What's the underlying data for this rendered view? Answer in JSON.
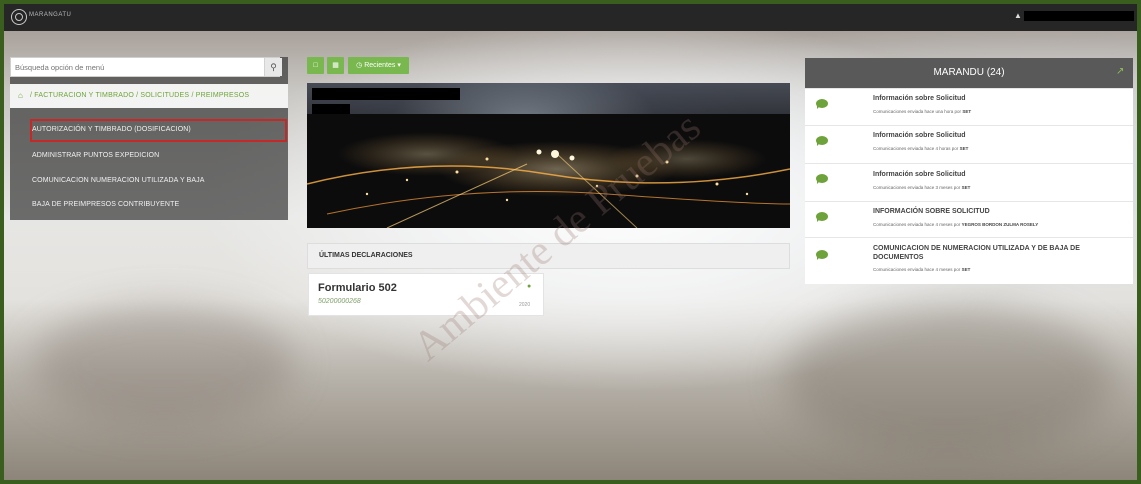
{
  "header": {
    "logo_text": "MARANGATU"
  },
  "search": {
    "placeholder": "Búsqueda opción de menú",
    "button_icon": "search-icon"
  },
  "breadcrumb": [
    "FACTURACION Y TIMBRADO",
    "SOLICITUDES",
    "PREIMPRESOS"
  ],
  "breadcrumb_text": "/ FACTURACION Y TIMBRADO / SOLICITUDES / PREIMPRESOS",
  "menu": [
    {
      "label": "AUTORIZACIÓN Y TIMBRADO (DOSIFICACION)",
      "selected": true
    },
    {
      "label": "ADMINISTRAR PUNTOS EXPEDICION"
    },
    {
      "label": "COMUNICACION NUMERACION UTILIZADA Y BAJA"
    },
    {
      "label": "BAJA DE PREIMPRESOS CONTRIBUYENTE"
    }
  ],
  "toolbar": {
    "recent_label": "Recientes"
  },
  "declarations": {
    "title": "ÚLTIMAS DECLARACIONES",
    "form": {
      "name": "Formulario 502",
      "number": "50200000268",
      "year": "2020"
    }
  },
  "marandu": {
    "title": "MARANDU (24)",
    "items": [
      {
        "title": "Información sobre Solicitud",
        "sub_prefix": "Comunicaciones enviada hace una hora por",
        "sender": "SET"
      },
      {
        "title": "Información sobre Solicitud",
        "sub_prefix": "Comunicaciones enviada hace 4 horas por",
        "sender": "SET"
      },
      {
        "title": "Información sobre Solicitud",
        "sub_prefix": "Comunicaciones enviada hace 3 meses por",
        "sender": "SET"
      },
      {
        "title": "INFORMACIÓN SOBRE SOLICITUD",
        "sub_prefix": "Comunicaciones enviada hace 4 meses por",
        "sender": "YEGROS BORDON ZULMA ROSELY"
      },
      {
        "title": "COMUNICACION DE NUMERACION UTILIZADA Y DE BAJA DE DOCUMENTOS",
        "sub_prefix": "Comunicaciones enviada hace 4 meses por",
        "sender": "SET"
      }
    ]
  },
  "watermark": "Ambiente de Pruebas",
  "colors": {
    "accent": "#78b84e",
    "topbar": "#262626",
    "border": "#3a5e1e",
    "highlight": "#c62828"
  }
}
